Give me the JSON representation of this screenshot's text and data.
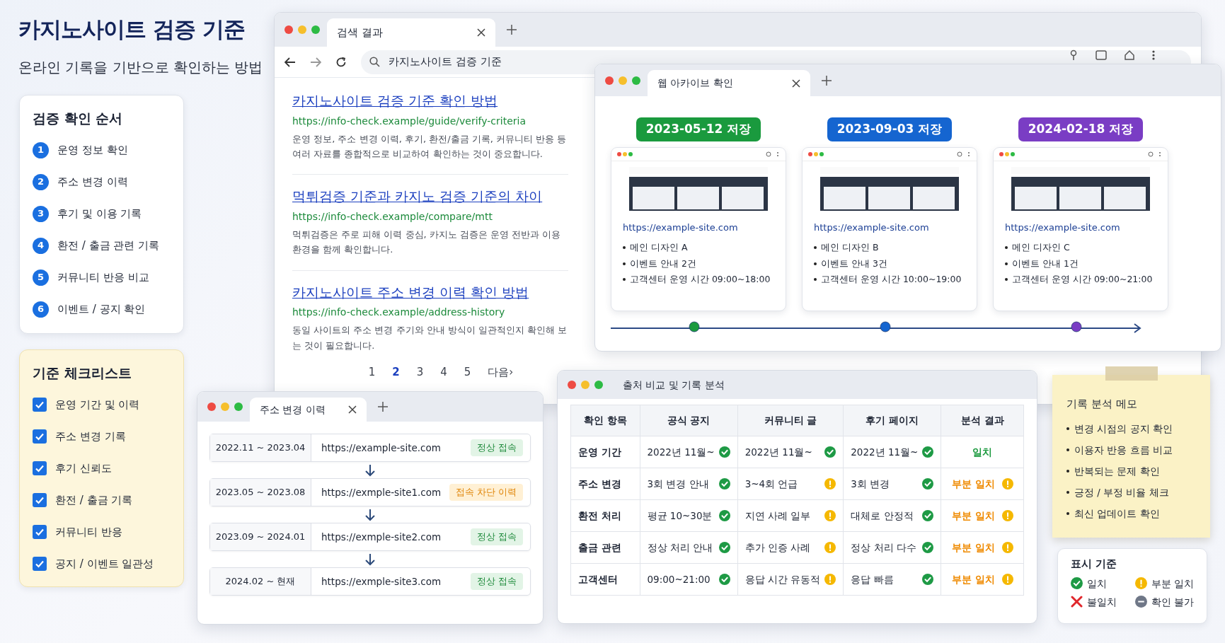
{
  "page": {
    "title": "카지노사이트 검증 기준",
    "subtitle": "온라인 기록을 기반으로 확인하는 방법"
  },
  "steps": {
    "title": "검증 확인 순서",
    "items": [
      {
        "number": "1",
        "label": "운영 정보 확인"
      },
      {
        "number": "2",
        "label": "주소 변경 이력"
      },
      {
        "number": "3",
        "label": "후기 및 이용 기록"
      },
      {
        "number": "4",
        "label": "환전 / 출금 관련 기록"
      },
      {
        "number": "5",
        "label": "커뮤니티 반응 비교"
      },
      {
        "number": "6",
        "label": "이벤트 / 공지 확인"
      }
    ]
  },
  "checklist": {
    "title": "기준 체크리스트",
    "items": [
      {
        "label": "운영 기간 및 이력",
        "checked": true
      },
      {
        "label": "주소 변경 기록",
        "checked": true
      },
      {
        "label": "후기 신뢰도",
        "checked": true
      },
      {
        "label": "환전 / 출금 기록",
        "checked": true
      },
      {
        "label": "커뮤니티 반응",
        "checked": true
      },
      {
        "label": "공지 / 이벤트 일관성",
        "checked": true
      }
    ]
  },
  "search_browser": {
    "tab": {
      "title": "검색 결과"
    },
    "query": "카지노사이트 검증 기준",
    "results": [
      {
        "title": "카지노사이트 검증 기준 확인 방법",
        "url": "https://info-check.example/guide/verify-criteria",
        "snippet": "운영 정보, 주소 변경 이력, 후기, 환전/출금 기록, 커뮤니티 반응 등 여러 자료를 종합적으로 비교하여 확인하는 것이 중요합니다."
      },
      {
        "title": "먹튀검증 기준과 카지노 검증 기준의 차이",
        "url": "https://info-check.example/compare/mtt",
        "snippet": "먹튀검증은 주로 피해 이력 중심, 카지노 검증은 운영 전반과 이용 환경을 함께 확인합니다."
      },
      {
        "title": "카지노사이트 주소 변경 이력 확인 방법",
        "url": "https://info-check.example/address-history",
        "snippet": "동일 사이트의 주소 변경 주기와 안내 방식이 일관적인지 확인해 보는 것이 필요합니다."
      }
    ],
    "pagination": [
      {
        "label": "1",
        "selected": false
      },
      {
        "label": "2",
        "selected": true
      },
      {
        "label": "3",
        "selected": false
      },
      {
        "label": "4",
        "selected": false
      },
      {
        "label": "5",
        "selected": false
      },
      {
        "label": "다음›",
        "selected": false
      }
    ]
  },
  "archive_window": {
    "tab": {
      "title": "웹 아카이브 확인"
    },
    "snapshots": [
      {
        "date_label": "2023-05-12 저장",
        "color": "#1a9a3e",
        "url": "https://example-site.com",
        "notes": [
          "메인 디자인 A",
          "이벤트 안내 2건",
          "고객센터 운영 시간 09:00~18:00"
        ]
      },
      {
        "date_label": "2023-09-03 저장",
        "color": "#1565d0",
        "url": "https://example-site.com",
        "notes": [
          "메인 디자인 B",
          "이벤트 안내 3건",
          "고객센터 운영 시간 10:00~19:00"
        ]
      },
      {
        "date_label": "2024-02-18 저장",
        "color": "#7a3dc4",
        "url": "https://example-site.com",
        "notes": [
          "메인 디자인 C",
          "이벤트 안내 1건",
          "고객센터 운영 시간 09:00~21:00"
        ]
      }
    ]
  },
  "address_window": {
    "tab": {
      "title": "주소 변경 이력"
    },
    "entries": [
      {
        "period": "2022.11 ~ 2023.04",
        "url": "https://example-site.com",
        "status": "정상 접속",
        "kind": "ok"
      },
      {
        "period": "2023.05 ~ 2023.08",
        "url": "https://exmple-site1.com",
        "status": "접속 차단 이력",
        "kind": "blocked"
      },
      {
        "period": "2023.09 ~ 2024.01",
        "url": "https://exmple-site2.com",
        "status": "정상 접속",
        "kind": "ok"
      },
      {
        "period": "2024.02 ~ 현재",
        "url": "https://exmple-site3.com",
        "status": "정상 접속",
        "kind": "ok"
      }
    ]
  },
  "comparison_window": {
    "title": "출처 비교 및 기록 분석",
    "columns": [
      "확인 항목",
      "공식 공지",
      "커뮤니티 글",
      "후기 페이지",
      "분석 결과"
    ],
    "rows": [
      {
        "cells": [
          {
            "text": "운영 기간",
            "kind": "label"
          },
          {
            "text": "2022년 11월~",
            "kind": "match"
          },
          {
            "text": "2022년 11월~",
            "kind": "match"
          },
          {
            "text": "2022년 11월~",
            "kind": "match"
          },
          {
            "text": "일치",
            "kind": "agreed"
          }
        ]
      },
      {
        "cells": [
          {
            "text": "주소 변경",
            "kind": "label"
          },
          {
            "text": "3회 변경 안내",
            "kind": "match"
          },
          {
            "text": "3~4회 언급",
            "kind": "partial"
          },
          {
            "text": "3회 변경",
            "kind": "match"
          },
          {
            "text": "부분 일치",
            "kind": "partly"
          }
        ]
      },
      {
        "cells": [
          {
            "text": "환전 처리",
            "kind": "label"
          },
          {
            "text": "평균 10~30분",
            "kind": "match"
          },
          {
            "text": "지연 사례 일부",
            "kind": "partial"
          },
          {
            "text": "대체로 안정적",
            "kind": "match"
          },
          {
            "text": "부분 일치",
            "kind": "partly"
          }
        ]
      },
      {
        "cells": [
          {
            "text": "출금 관련",
            "kind": "label"
          },
          {
            "text": "정상 처리 안내",
            "kind": "match"
          },
          {
            "text": "추가 인증 사례",
            "kind": "partial"
          },
          {
            "text": "정상 처리 다수",
            "kind": "match"
          },
          {
            "text": "부분 일치",
            "kind": "partly"
          }
        ]
      },
      {
        "cells": [
          {
            "text": "고객센터",
            "kind": "label"
          },
          {
            "text": "09:00~21:00",
            "kind": "match"
          },
          {
            "text": "응답 시간 유동적",
            "kind": "partial"
          },
          {
            "text": "응답 빠름",
            "kind": "match"
          },
          {
            "text": "부분 일치",
            "kind": "partly"
          }
        ]
      }
    ]
  },
  "memo": {
    "title": "기록 분석 메모",
    "items": [
      "변경 시점의 공지 확인",
      "이용자 반응 흐름 비교",
      "반복되는 문제 확인",
      "긍정 / 부정 비율 체크",
      "최신 업데이트 확인"
    ]
  },
  "legend": {
    "title": "표시 기준",
    "items": [
      {
        "label": "일치",
        "kind": "match"
      },
      {
        "label": "부분 일치",
        "kind": "partial"
      },
      {
        "label": "불일치",
        "kind": "mismatch"
      },
      {
        "label": "확인 불가",
        "kind": "unknown"
      }
    ]
  }
}
